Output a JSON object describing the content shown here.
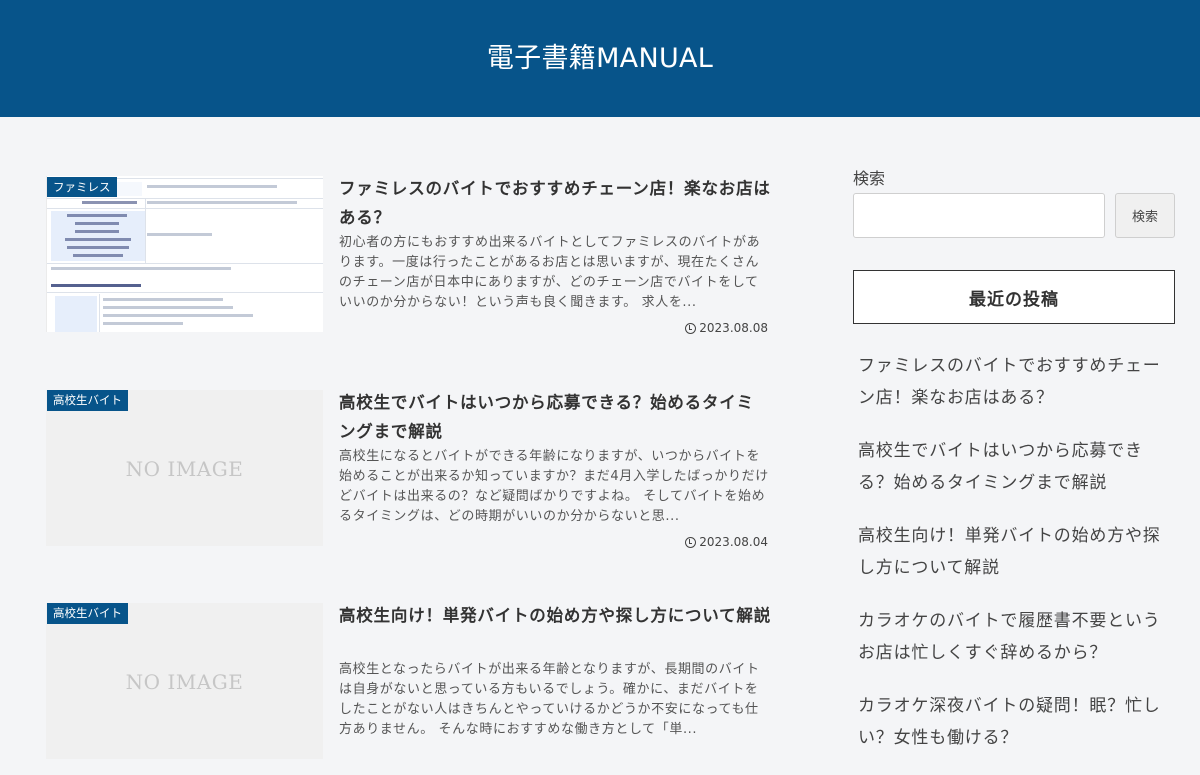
{
  "header": {
    "site_title": "電子書籍MANUAL"
  },
  "posts": [
    {
      "category": "ファミレス",
      "title": "ファミレスのバイトでおすすめチェーン店！楽なお店はある？",
      "excerpt": "初心者の方にもおすすめ出来るバイトとしてファミレスのバイトがあります。一度は行ったことがあるお店とは思いますが、現在たくさんのチェーン店が日本中にありますが、どのチェーン店でバイトをしていいのか分からない！という声も良く聞きます。 求人を...",
      "date": "2023.08.08"
    },
    {
      "category": "高校生バイト",
      "title": "高校生でバイトはいつから応募できる？始めるタイミングまで解説",
      "excerpt": "高校生になるとバイトができる年齢になりますが、いつからバイトを始めることが出来るか知っていますか？まだ4月入学したばっかりだけどバイトは出来るの？など疑問ばかりですよね。 そしてバイトを始めるタイミングは、どの時期がいいのか分からないと思...",
      "date": "2023.08.04",
      "thumb_text": "NO IMAGE"
    },
    {
      "category": "高校生バイト",
      "title": "高校生向け！単発バイトの始め方や探し方について解説",
      "excerpt": "高校生となったらバイトが出来る年齢となりますが、長期間のバイトは自身がないと思っている方もいるでしょう。確かに、まだバイトをしたことがない人はきちんとやっていけるかどうか不安になっても仕方ありません。 そんな時におすすめな働き方として「単...",
      "thumb_text": "NO IMAGE"
    }
  ],
  "thumb1_text": {
    "a": "auかんたん決済(携帯電話料金合算支払い)のみ",
    "b": "MySoftBank認証",
    "c": "ソフトバンクまとめて支払い(携帯電話料金合算支払い)のみ",
    "d": "「メールアドレス認証」",
    "e": "「LINE認証」",
    "f": "「Twitter認証」",
    "g": "「Facebookアカウント認証」",
    "h": "「Googleアカウント認証」",
    "i": "「AppleID認証」",
    "j": "クレジットカード決済のみ",
    "k": "■ポイント追加料金の支払い方法",
    "l": "「spモード決済(携帯電話料金合算支払い)」",
    "m": "「auかんたん決済(携帯電話料金合算支払い)」",
    "n": "「ソフトバンクまとめて支払い(携帯電話料金合算支払い)」",
    "o": "「クレジットカード決済」"
  },
  "sidebar": {
    "search_label": "検索",
    "search_value": "",
    "search_button": "検索",
    "recent_heading": "最近の投稿",
    "recent_posts": [
      "ファミレスのバイトでおすすめチェーン店！楽なお店はある？",
      "高校生でバイトはいつから応募できる？始めるタイミングまで解説",
      "高校生向け！単発バイトの始め方や探し方について解説",
      "カラオケのバイトで履歴書不要というお店は忙しくすぐ辞めるから？",
      "カラオケ深夜バイトの疑問！眠？忙しい？女性も働ける？"
    ]
  },
  "colors": {
    "brand": "#07548a",
    "background": "#f4f5f7"
  }
}
